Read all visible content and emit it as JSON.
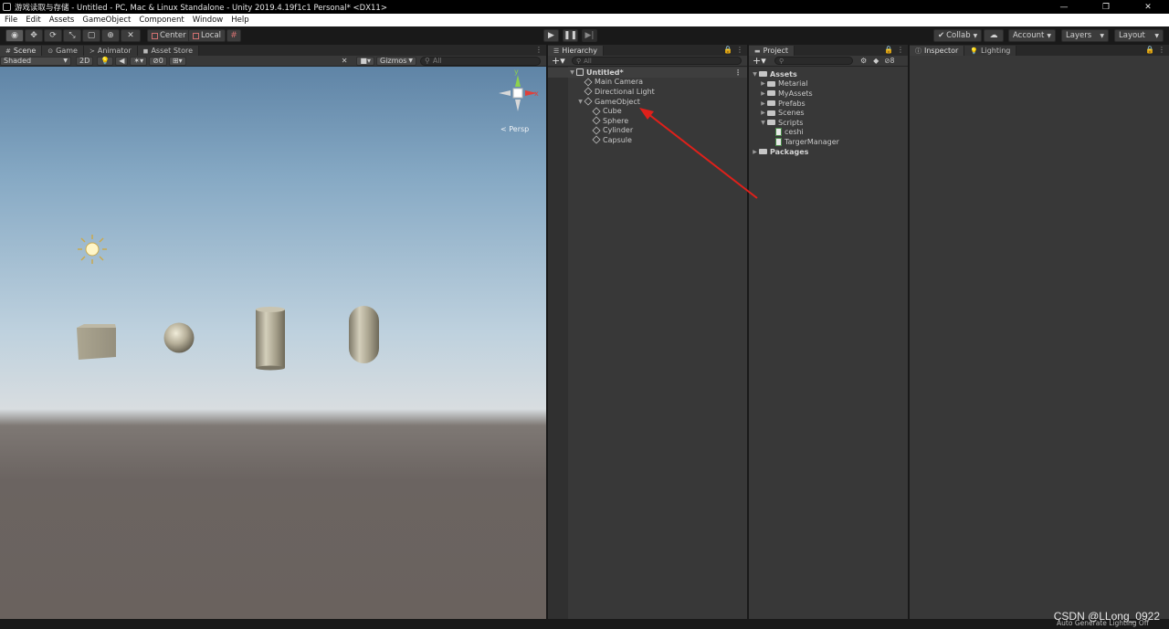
{
  "window": {
    "title": "游戏读取与存储 - Untitled - PC, Mac & Linux Standalone - Unity 2019.4.19f1c1 Personal* <DX11>",
    "controls": [
      "—",
      "❐",
      "✕"
    ]
  },
  "menu": [
    "File",
    "Edit",
    "Assets",
    "GameObject",
    "Component",
    "Window",
    "Help"
  ],
  "toolbar": {
    "pivot_label": "Center",
    "space_label": "Local",
    "collab_label": "Collab",
    "account_label": "Account",
    "layers_label": "Layers",
    "layout_label": "Layout"
  },
  "scene_panel": {
    "tabs": [
      "Scene",
      "Game",
      "Animator",
      "Asset Store"
    ],
    "shading_mode": "Shaded",
    "mode_2d": "2D",
    "hidden_count": "0",
    "gizmos_label": "Gizmos",
    "search_placeholder": "All",
    "view_label": "Persp",
    "axis_labels": [
      "y",
      "x"
    ]
  },
  "hierarchy": {
    "tab": "Hierarchy",
    "search_placeholder": "All",
    "scene_name": "Untitled*",
    "items": [
      "Main Camera",
      "Directional Light",
      "GameObject"
    ],
    "children": [
      "Cube",
      "Sphere",
      "Cylinder",
      "Capsule"
    ]
  },
  "project": {
    "tab": "Project",
    "hidden_count": "8",
    "root": "Assets",
    "folders": [
      "Metarial",
      "MyAssets",
      "Prefabs",
      "Scenes",
      "Scripts"
    ],
    "scripts": [
      "ceshi",
      "TargerManager"
    ],
    "packages": "Packages"
  },
  "inspector": {
    "tabs": [
      "Inspector",
      "Lighting"
    ]
  },
  "status": {
    "text": "Auto Generate Lighting Off"
  },
  "watermark": "CSDN @LLong_0922",
  "colors": {
    "annotation_arrow": "#e0201a",
    "selection_highlight": "#3e3e3e",
    "panel_bg": "#383838"
  }
}
